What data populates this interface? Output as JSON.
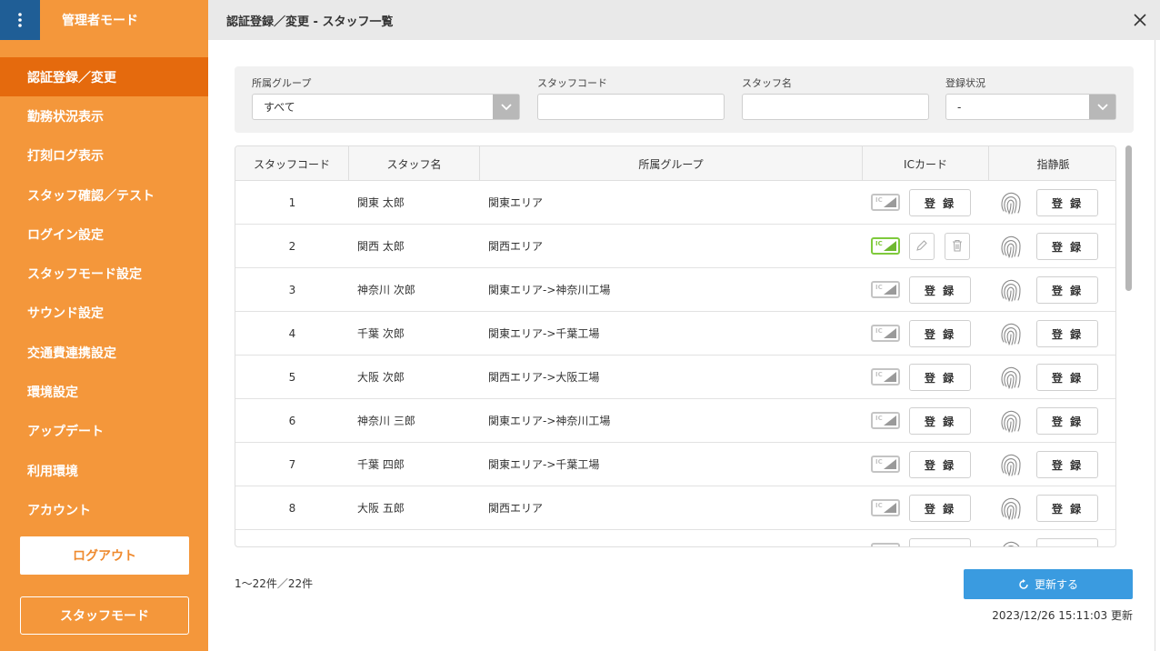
{
  "sidebar": {
    "title": "管理者モード",
    "items": [
      {
        "label": "認証登録／変更"
      },
      {
        "label": "勤務状況表示"
      },
      {
        "label": "打刻ログ表示"
      },
      {
        "label": "スタッフ確認／テスト"
      },
      {
        "label": "ログイン設定"
      },
      {
        "label": "スタッフモード設定"
      },
      {
        "label": "サウンド設定"
      },
      {
        "label": "交通費連携設定"
      },
      {
        "label": "環境設定"
      },
      {
        "label": "アップデート"
      },
      {
        "label": "利用環境"
      },
      {
        "label": "アカウント"
      }
    ],
    "logout_label": "ログアウト",
    "staff_mode_label": "スタッフモード"
  },
  "header": {
    "title": "認証登録／変更 - スタッフ一覧",
    "close_icon": "close-icon"
  },
  "filter": {
    "group_label": "所属グループ",
    "group_value": "すべて",
    "code_label": "スタッフコード",
    "code_value": "",
    "name_label": "スタッフ名",
    "name_value": "",
    "status_label": "登録状況",
    "status_value": "-"
  },
  "table": {
    "headers": [
      "スタッフコード",
      "スタッフ名",
      "所属グループ",
      "ICカード",
      "指静脈"
    ],
    "register_label": "登 録",
    "rows": [
      {
        "code": "1",
        "name": "関東 太郎",
        "group": "関東エリア",
        "ic_registered": false
      },
      {
        "code": "2",
        "name": "関西 太郎",
        "group": "関西エリア",
        "ic_registered": true
      },
      {
        "code": "3",
        "name": "神奈川 次郎",
        "group": "関東エリア->神奈川工場",
        "ic_registered": false
      },
      {
        "code": "4",
        "name": "千葉 次郎",
        "group": "関東エリア->千葉工場",
        "ic_registered": false
      },
      {
        "code": "5",
        "name": "大阪 次郎",
        "group": "関西エリア->大阪工場",
        "ic_registered": false
      },
      {
        "code": "6",
        "name": "神奈川 三郎",
        "group": "関東エリア->神奈川工場",
        "ic_registered": false
      },
      {
        "code": "7",
        "name": "千葉 四郎",
        "group": "関東エリア->千葉工場",
        "ic_registered": false
      },
      {
        "code": "8",
        "name": "大阪 五郎",
        "group": "関西エリア",
        "ic_registered": false
      }
    ]
  },
  "footer": {
    "count_text": "1～22件／22件",
    "refresh_label": "更新する",
    "updated_text": "2023/12/26 15:11:03 更新"
  },
  "colors": {
    "sidebar": "#f4973b",
    "sidebar_active": "#e56a0d",
    "menu_button": "#1f5e96",
    "refresh": "#3a9be0",
    "ic_registered": "#7fca3c"
  }
}
